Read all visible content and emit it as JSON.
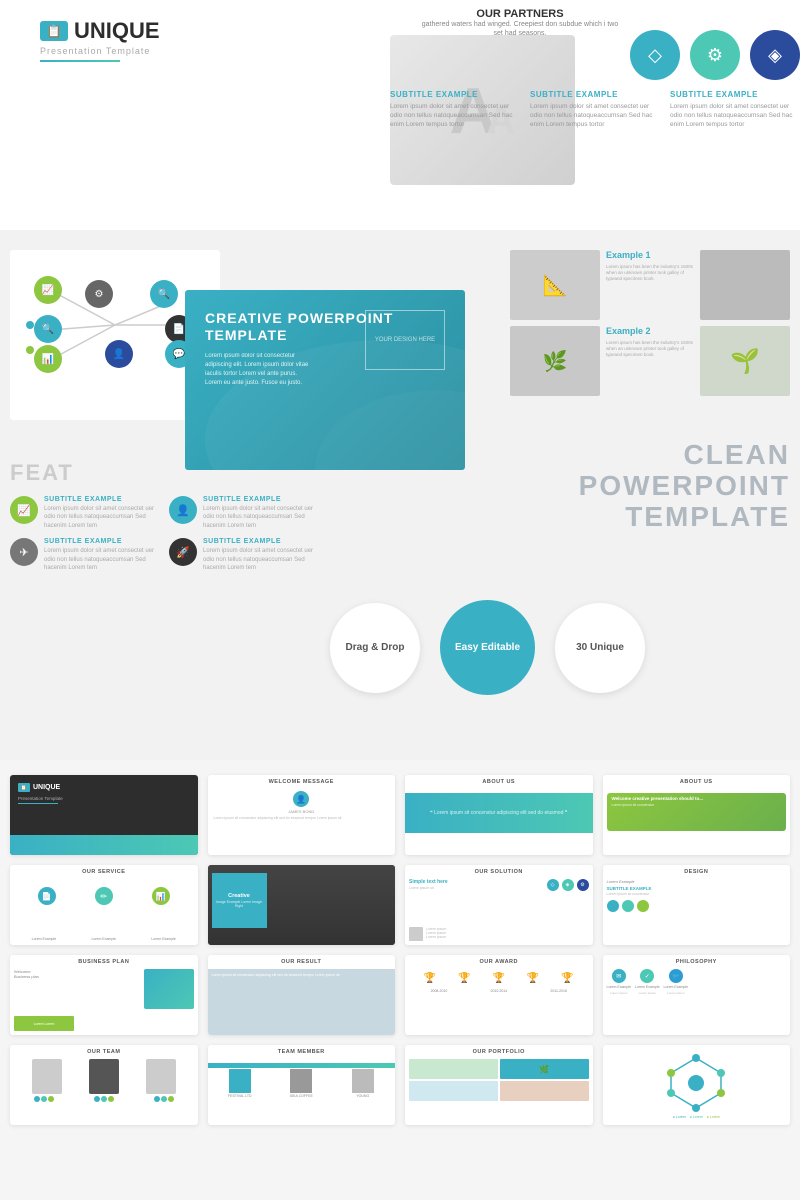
{
  "brand": {
    "name": "UNIQUE",
    "subtitle": "Presentation Template",
    "icon_symbol": "📋"
  },
  "top_section": {
    "partners_title": "OUR PARTNERS",
    "partners_text": "gathered waters had winged. Creepiest don subdue which i two set had seasons.",
    "icons": [
      {
        "name": "diamond",
        "symbol": "◇",
        "color": "icon-blue"
      },
      {
        "name": "gear",
        "symbol": "⚙",
        "color": "icon-teal"
      },
      {
        "name": "chart",
        "symbol": "◈",
        "color": "icon-darkblue"
      }
    ],
    "subtitle_example": "SUBTITLE EXAMPLE",
    "lorem_text": "Lorem ipsum dolor sit amet consectet uer odio non tellus natoqueaccumsan Sed hac enim Lorem tempus tortor"
  },
  "slides": {
    "creative_title": "CREATIVE POWERPOINT TEMPLATE",
    "creative_placeholder": "YOUR DESIGN HERE",
    "clean_title": "CLEAN POWERPOINT TEMPLATE",
    "feat_label": "FEAT",
    "features": [
      {
        "icon": "📈",
        "color": "fi-green",
        "title": "SUBTITLE EXAMPLE",
        "text": "Lorem ipsum dolor sit amet consectet uer odio non tellus natoqueaccumsan Sed hacenim Lorem tem"
      },
      {
        "icon": "👤",
        "color": "fi-teal",
        "title": "SUBTITLE EXAMPLE",
        "text": "Lorem ipsum dolor sit amet consectet uer odio non tellus natoqueaccumsan Sed hacenim Lorem tem"
      },
      {
        "icon": "✈",
        "color": "fi-gray",
        "title": "SUBTITLE EXAMPLE",
        "text": "Lorem ipsum dolor sit amet consectet uer odio non tellus natoqueaccumsan Sed hacenim Lorem tem"
      },
      {
        "icon": "🚀",
        "color": "fi-dark",
        "title": "SUBTITLE EXAMPLE",
        "text": "Lorem ipsum dolor sit amet consectet uer odio non tellus natoqueaccumsan Sed hacenim Lorem tem"
      }
    ],
    "example1_title": "Example 1",
    "example1_text": "Lorem ipsum has been the industry's 1500s when an unknown printer took galley of typeand specimen book.",
    "example2_title": "Example 2",
    "example2_text": "Lorem ipsum has been the industry's 1500s when an unknown printer took galley of typeand specimen book.",
    "badges": [
      {
        "label": "Drag & Drop",
        "style": "badge-white"
      },
      {
        "label": "Easy Editable",
        "style": "badge-teal"
      },
      {
        "label": "30 Unique",
        "style": "badge-white"
      }
    ]
  },
  "thumbnails": [
    {
      "id": "thumb-cover",
      "label": "",
      "type": "dark"
    },
    {
      "id": "thumb-welcome",
      "label": "WELCOME MESSAGE",
      "type": "welcome"
    },
    {
      "id": "thumb-about1",
      "label": "ABOUT US",
      "type": "about1"
    },
    {
      "id": "thumb-about2-r",
      "label": "ABOUT US",
      "type": "about2"
    },
    {
      "id": "thumb-service",
      "label": "OUR SERVICE",
      "type": "service"
    },
    {
      "id": "thumb-creative-img",
      "label": "",
      "type": "creative-img"
    },
    {
      "id": "thumb-solution",
      "label": "OUR SOLUTION",
      "type": "solution"
    },
    {
      "id": "thumb-design",
      "label": "DESIGN",
      "type": "design"
    },
    {
      "id": "thumb-biz",
      "label": "BUSINESS PLAN",
      "type": "biz"
    },
    {
      "id": "thumb-result",
      "label": "OUR RESULT",
      "type": "result"
    },
    {
      "id": "thumb-award",
      "label": "OUR AWARD",
      "type": "award"
    },
    {
      "id": "thumb-philosophy",
      "label": "PHILOSOPHY",
      "type": "philosophy"
    },
    {
      "id": "thumb-team",
      "label": "OUR TEAM",
      "type": "team"
    },
    {
      "id": "thumb-member",
      "label": "TEAM MEMBER",
      "type": "team-member"
    },
    {
      "id": "thumb-portfolio",
      "label": "OUR PORTFOLIO",
      "type": "portfolio"
    },
    {
      "id": "thumb-last",
      "label": "",
      "type": "last"
    }
  ]
}
